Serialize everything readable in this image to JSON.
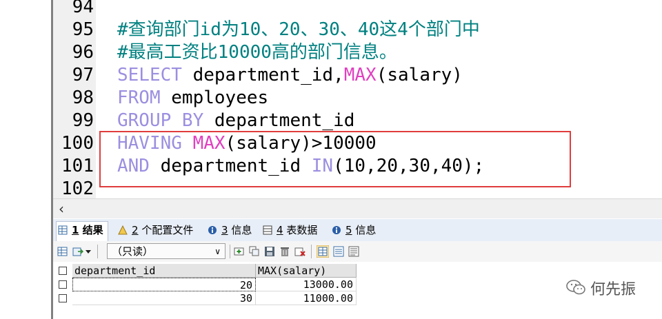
{
  "editor": {
    "lines": [
      {
        "num": "94",
        "parts": []
      },
      {
        "num": "95",
        "parts": [
          {
            "t": "#查询部门id为10、20、30、40这4个部门中",
            "c": "cmt"
          }
        ]
      },
      {
        "num": "96",
        "parts": [
          {
            "t": "#最高工资比10000高的部门信息。",
            "c": "cmt"
          }
        ]
      },
      {
        "num": "97",
        "parts": [
          {
            "t": "SELECT",
            "c": "kw"
          },
          {
            "t": " department_id,",
            "c": "tx"
          },
          {
            "t": "MAX",
            "c": "fn"
          },
          {
            "t": "(salary)",
            "c": "tx"
          }
        ]
      },
      {
        "num": "98",
        "parts": [
          {
            "t": "FROM",
            "c": "kw"
          },
          {
            "t": " employees",
            "c": "tx"
          }
        ]
      },
      {
        "num": "99",
        "parts": [
          {
            "t": "GROUP BY",
            "c": "kw"
          },
          {
            "t": " department_id",
            "c": "tx"
          }
        ]
      },
      {
        "num": "100",
        "parts": [
          {
            "t": "HAVING",
            "c": "kw"
          },
          {
            "t": " ",
            "c": "tx"
          },
          {
            "t": "MAX",
            "c": "fn"
          },
          {
            "t": "(salary)>10000",
            "c": "tx"
          }
        ]
      },
      {
        "num": "101",
        "parts": [
          {
            "t": "AND",
            "c": "kw"
          },
          {
            "t": " department_id ",
            "c": "tx"
          },
          {
            "t": "IN",
            "c": "kw"
          },
          {
            "t": "(10,20,30,40);",
            "c": "tx"
          }
        ]
      },
      {
        "num": "102",
        "parts": []
      }
    ]
  },
  "tabs": [
    {
      "num": "1",
      "label": " 结果",
      "icon": "results-grid-icon",
      "active": true
    },
    {
      "num": "2",
      "label": " 个配置文件",
      "icon": "profile-icon",
      "active": false
    },
    {
      "num": "3",
      "label": " 信息",
      "icon": "info-icon",
      "active": false
    },
    {
      "num": "4",
      "label": " 表数据",
      "icon": "table-data-icon",
      "active": false
    },
    {
      "num": "5",
      "label": " 信息",
      "icon": "info-icon",
      "active": false
    }
  ],
  "toolbar": {
    "readonly_label": "（只读）",
    "readonly_arrow": "∨"
  },
  "results": {
    "columns": [
      "department_id",
      "MAX(salary)"
    ],
    "rows": [
      [
        "20",
        "13000.00"
      ],
      [
        "30",
        "11000.00"
      ]
    ]
  },
  "watermark": {
    "text": "何先振",
    "icon": "wechat-icon"
  },
  "colors": {
    "keyword": "#9b8fe0",
    "function": "#e040c0",
    "comment": "#008080",
    "highlight_box": "#e03c3c"
  }
}
